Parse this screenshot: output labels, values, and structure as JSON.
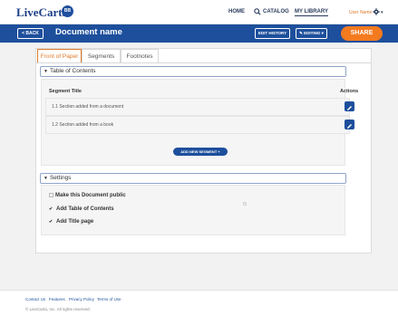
{
  "app": {
    "logo": "LiveCarta",
    "badge": "BB"
  },
  "nav": {
    "home": "HOME",
    "catalog": "CATALOG",
    "my_library": "MY LIBRARY",
    "user_name": "User Name"
  },
  "header": {
    "back": "< BACK",
    "document_name": "Document name",
    "edit_history": "EDIT HISTORY",
    "editing": "✎ EDITING ▾",
    "share": "SHARE"
  },
  "tabs": [
    "Front of Paper",
    "Segments",
    "Footnotes"
  ],
  "toc": {
    "title": "Table of Contents",
    "col_segment_title": "Segment Title",
    "col_actions": "Actions",
    "rows": [
      "1.1 Section added from a document",
      "1.2 Section added from a  book"
    ],
    "add_segment": "ADD NEW SEGMENT  +"
  },
  "settings": {
    "title": "Settings",
    "options": [
      {
        "label": "Make this Document public",
        "checked": false
      },
      {
        "label": "Add Table of Contents",
        "checked": true
      },
      {
        "label": "Add Title page",
        "checked": true
      }
    ]
  },
  "footer": {
    "links": [
      "Contact Us",
      "Features",
      "Privacy Policy",
      "Terms of Use"
    ],
    "copyright": "© LiveCarta, Inc. All rights reserved."
  },
  "colors": {
    "brand_blue": "#1d4f9c",
    "accent_orange": "#f47a20"
  }
}
